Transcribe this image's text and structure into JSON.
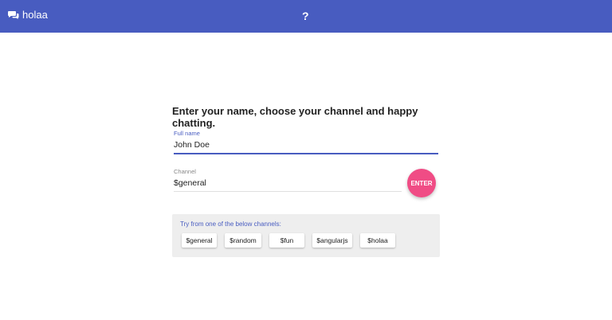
{
  "header": {
    "brand_name": "holaa",
    "brand_icon": "chat-bubbles-icon",
    "help_label": "?",
    "bar_color": "#485cc0"
  },
  "main": {
    "headline": "Enter your name, choose your channel and happy chatting.",
    "name_field": {
      "label": "Full name",
      "value": "John Doe"
    },
    "channel_field": {
      "label": "Channel",
      "value": "$general"
    },
    "enter_label": "ENTER",
    "enter_color": "#f04c85",
    "channels": {
      "hint": "Try from one of the below channels:",
      "items": [
        {
          "label": "$general"
        },
        {
          "label": "$random"
        },
        {
          "label": "$fun"
        },
        {
          "label": "$angularjs"
        },
        {
          "label": "$holaa"
        }
      ]
    }
  }
}
